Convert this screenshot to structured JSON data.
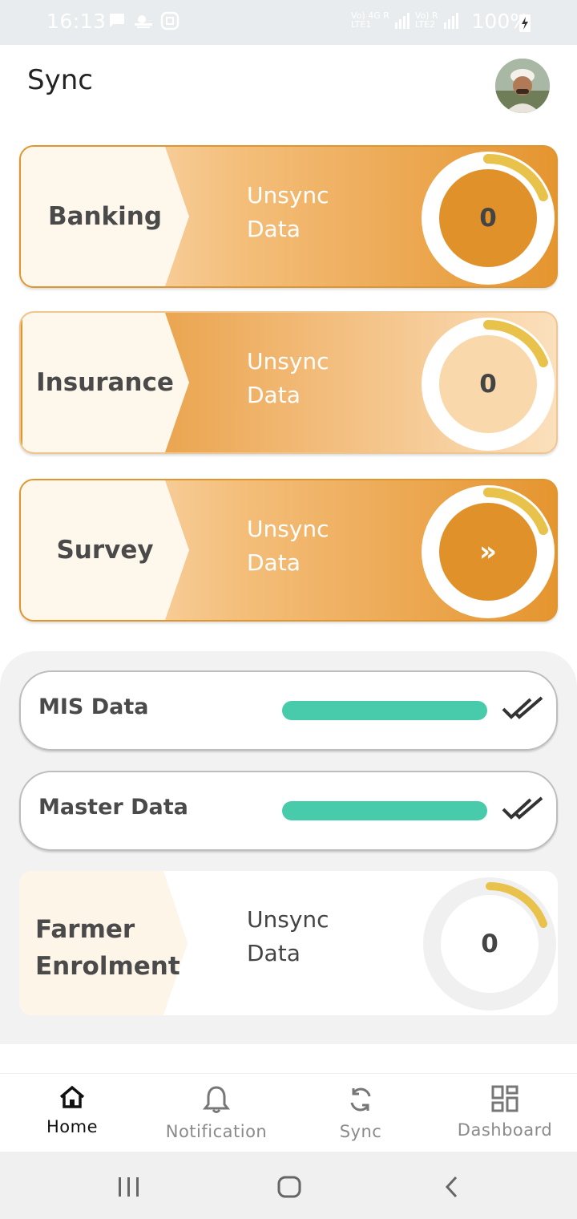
{
  "status_bar": {
    "time": "16:13",
    "network_1": "Vo) 4G R",
    "network_1_sub": "LTE1",
    "network_2": "Vo) R",
    "network_2_sub": "LTE2",
    "battery": "100%"
  },
  "header": {
    "title": "Sync"
  },
  "cards": [
    {
      "label": "Banking",
      "unsync_line1": "Unsync",
      "unsync_line2": "Data",
      "count": "0"
    },
    {
      "label": "Insurance",
      "unsync_line1": "Unsync",
      "unsync_line2": "Data",
      "count": "0"
    },
    {
      "label": "Survey",
      "unsync_line1": "Unsync",
      "unsync_line2": "Data",
      "count": "»"
    }
  ],
  "data_rows": [
    {
      "label": "MIS Data",
      "progress": 1.0
    },
    {
      "label": "Master Data",
      "progress": 1.0
    }
  ],
  "farmer_card": {
    "label_line1": "Farmer",
    "label_line2": "Enrolment",
    "unsync_line1": "Unsync",
    "unsync_line2": "Data",
    "count": "0"
  },
  "bottom_nav": [
    {
      "label": "Home",
      "icon": "home-icon",
      "active": true
    },
    {
      "label": "Notification",
      "icon": "bell-icon",
      "active": false
    },
    {
      "label": "Sync",
      "icon": "sync-icon",
      "active": false
    },
    {
      "label": "Dashboard",
      "icon": "dashboard-icon",
      "active": false
    }
  ],
  "colors": {
    "accent_orange": "#e0962e",
    "progress_green": "#48cbaa",
    "arc_yellow": "#e8c24a"
  }
}
